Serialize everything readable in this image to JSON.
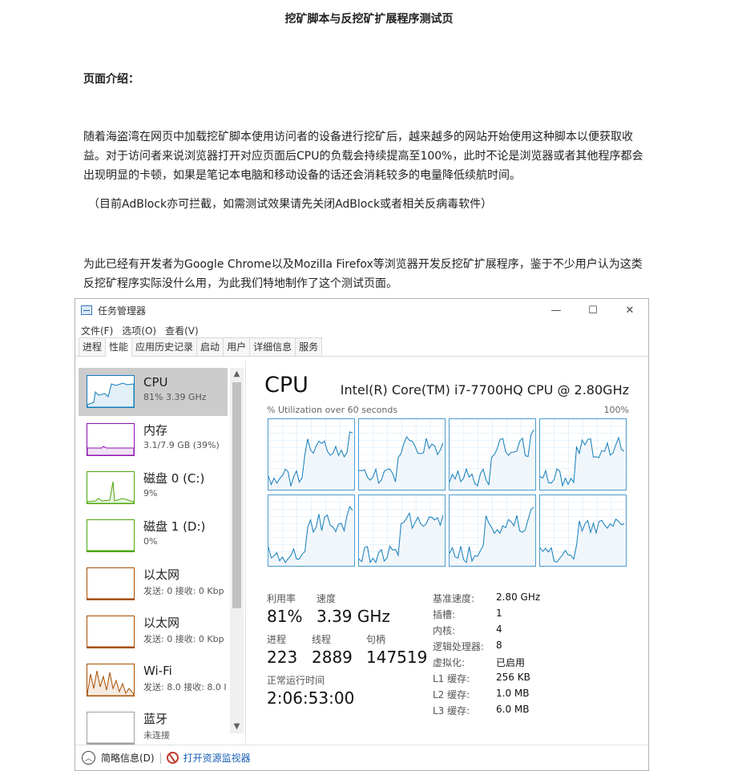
{
  "page": {
    "title": "挖矿脚本与反挖矿扩展程序测试页",
    "intro_heading": "页面介绍：",
    "paragraphs": [
      "随着海盗湾在网页中加载挖矿脚本使用访问者的设备进行挖矿后，越来越多的网站开始使用这种脚本以便获取收益。对于访问者来说浏览器打开对应页面后CPU的负载会持续提高至100%，此时不论是浏览器或者其他程序都会出现明显的卡顿，如果是笔记本电脑和移动设备的话还会消耗较多的电量降低续航时间。",
      "（目前AdBlock亦可拦截，如需测试效果请先关闭AdBlock或者相关反病毒软件）",
      "为此已经有开发者为Google Chrome以及Mozilla Firefox等浏览器开发反挖矿扩展程序，鉴于不少用户认为这类反挖矿程序实际没什么用，为此我们特地制作了这个测试页面。"
    ]
  },
  "task_manager": {
    "window_title": "任务管理器",
    "menu": [
      "文件(F)",
      "选项(O)",
      "查看(V)"
    ],
    "tabs": [
      "进程",
      "性能",
      "应用历史记录",
      "启动",
      "用户",
      "详细信息",
      "服务"
    ],
    "active_tab": "性能",
    "window_controls": {
      "minimize": "—",
      "maximize": "☐",
      "close": "✕"
    },
    "sidebar": [
      {
        "name": "CPU",
        "sub": "81%  3.39 GHz",
        "color": "#117dbb",
        "active": true
      },
      {
        "name": "内存",
        "sub": "3.1/7.9 GB (39%)",
        "color": "#8b12ae"
      },
      {
        "name": "磁盘 0 (C:)",
        "sub": "9%",
        "color": "#4da60c"
      },
      {
        "name": "磁盘 1 (D:)",
        "sub": "0%",
        "color": "#4da60c"
      },
      {
        "name": "以太网",
        "sub": "发送: 0  接收: 0 Kbp",
        "color": "#a74f01"
      },
      {
        "name": "以太网",
        "sub": "发送: 0  接收: 0 Kbp",
        "color": "#a74f01"
      },
      {
        "name": "Wi-Fi",
        "sub": "发送: 8.0  接收: 8.0 I",
        "color": "#a74f01"
      },
      {
        "name": "蓝牙",
        "sub": "未连接",
        "color": "#a0a0a0"
      }
    ],
    "cpu": {
      "title": "CPU",
      "model": "Intel(R) Core(TM) i7-7700HQ CPU @ 2.80GHz",
      "util_label": "% Utilization over 60 seconds",
      "util_max": "100%",
      "graph_color": "#117dbb",
      "stats": [
        {
          "label": "利用率",
          "value": "81%"
        },
        {
          "label": "速度",
          "value": "3.39 GHz"
        },
        {
          "label": "进程",
          "value": "223"
        },
        {
          "label": "线程",
          "value": "2889"
        },
        {
          "label": "句柄",
          "value": "147519"
        },
        {
          "label": "正常运行时间",
          "value": "2:06:53:00"
        }
      ],
      "specs": [
        {
          "k": "基准速度:",
          "v": "2.80 GHz"
        },
        {
          "k": "插槽:",
          "v": "1"
        },
        {
          "k": "内核:",
          "v": "4"
        },
        {
          "k": "逻辑处理器:",
          "v": "8"
        },
        {
          "k": "虚拟化:",
          "v": "已启用"
        },
        {
          "k": "L1 缓存:",
          "v": "256 KB"
        },
        {
          "k": "L2 缓存:",
          "v": "1.0 MB"
        },
        {
          "k": "L3 缓存:",
          "v": "6.0 MB"
        }
      ]
    },
    "footer": {
      "fewer_details": "简略信息(D)",
      "open_monitor": "打开资源监视器"
    }
  }
}
